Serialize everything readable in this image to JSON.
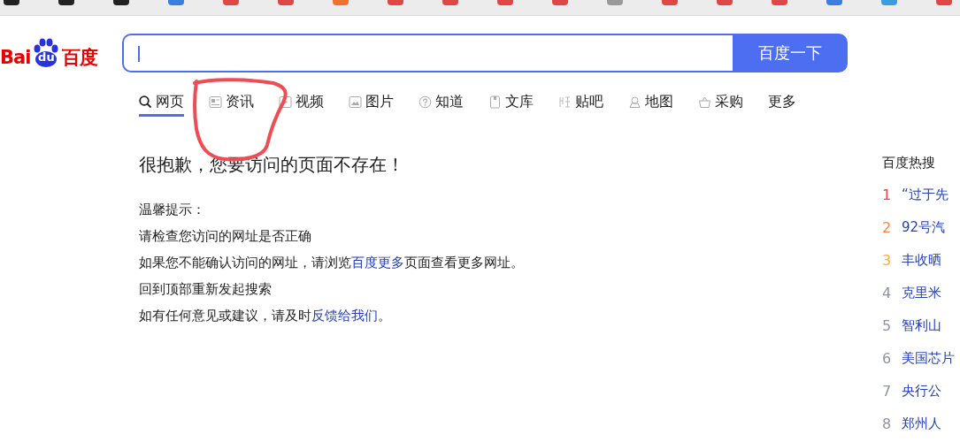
{
  "logo": {
    "left": "Bai",
    "paw": "du",
    "right": "百度"
  },
  "search": {
    "button": "百度一下"
  },
  "tabs": [
    {
      "label": "网页",
      "selected": true
    },
    {
      "label": "资讯",
      "selected": false
    },
    {
      "label": "视频",
      "selected": false
    },
    {
      "label": "图片",
      "selected": false
    },
    {
      "label": "知道",
      "selected": false
    },
    {
      "label": "文库",
      "selected": false
    },
    {
      "label": "贴吧",
      "selected": false
    },
    {
      "label": "地图",
      "selected": false
    },
    {
      "label": "采购",
      "selected": false
    },
    {
      "label": "更多",
      "selected": false
    }
  ],
  "error": {
    "title": "很抱歉，您要访问的页面不存在！",
    "tips": [
      {
        "text": "温馨提示："
      },
      {
        "text": "请检查您访问的网址是否正确"
      },
      {
        "text": "如果您不能确认访问的网址，请浏览",
        "link": "百度更多",
        "after": "页面查看更多网址。"
      },
      {
        "text": "回到顶部重新发起搜索"
      },
      {
        "text": "如有任何意见或建议，请及时",
        "link": "反馈给我们",
        "after": "。"
      }
    ]
  },
  "hot": {
    "title": "百度热搜",
    "items": [
      {
        "rank": "1",
        "text": "“过于先",
        "color": "#f54545"
      },
      {
        "rank": "2",
        "text": "92号汽",
        "color": "#ff8547"
      },
      {
        "rank": "3",
        "text": "丰收晒",
        "color": "#ffac38"
      },
      {
        "rank": "4",
        "text": "克里米",
        "color": "#9195a3"
      },
      {
        "rank": "5",
        "text": "智利山",
        "color": "#9195a3"
      },
      {
        "rank": "6",
        "text": "美国芯片",
        "color": "#9195a3"
      },
      {
        "rank": "7",
        "text": "央行公",
        "color": "#9195a3"
      },
      {
        "rank": "8",
        "text": "郑州人",
        "color": "#9195a3"
      }
    ]
  }
}
